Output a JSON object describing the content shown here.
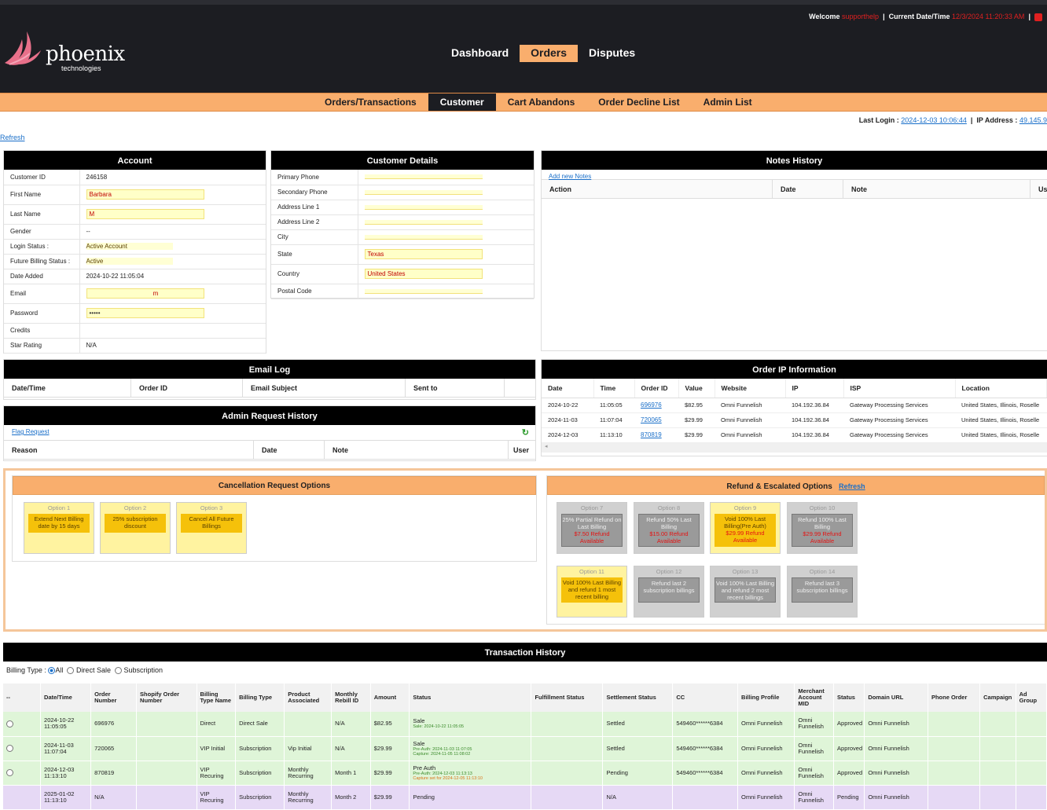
{
  "header": {
    "welcome_label": "Welcome",
    "username": "supporthelp",
    "datetime_label": "Current Date/Time",
    "datetime": "12/3/2024 11:20:33 AM",
    "separator": "|"
  },
  "logo": {
    "word": "phoenix",
    "sub": "technologies"
  },
  "main_nav": [
    {
      "label": "Dashboard",
      "active": false
    },
    {
      "label": "Orders",
      "active": true
    },
    {
      "label": "Disputes",
      "active": false
    }
  ],
  "sub_nav": [
    {
      "label": "Orders/Transactions",
      "active": false
    },
    {
      "label": "Customer",
      "active": true
    },
    {
      "label": "Cart Abandons",
      "active": false
    },
    {
      "label": "Order Decline List",
      "active": false
    },
    {
      "label": "Admin List",
      "active": false
    }
  ],
  "last_login": {
    "label": "Last Login :",
    "value": "2024-12-03 10:06:44",
    "ip_label": "IP Address :",
    "ip_value": "49.145.9"
  },
  "refresh_link": "Refresh",
  "account": {
    "title": "Account",
    "rows": [
      {
        "k": "Customer ID",
        "v": "246158"
      },
      {
        "k": "First Name",
        "v": "Barbara"
      },
      {
        "k": "Last Name",
        "v": "M"
      },
      {
        "k": "Gender",
        "v": "--"
      },
      {
        "k": "Login Status :",
        "v": "Active Account"
      },
      {
        "k": "Future Billing Status :",
        "v": "Active"
      },
      {
        "k": "Date Added",
        "v": "2024-10-22 11:05:04"
      },
      {
        "k": "Email",
        "v": "m"
      },
      {
        "k": "Password",
        "v": "•••••"
      },
      {
        "k": "Credits",
        "v": ""
      },
      {
        "k": "Star Rating",
        "v": "N/A"
      }
    ]
  },
  "customer_details": {
    "title": "Customer Details",
    "rows": [
      {
        "k": "Primary Phone",
        "v": ""
      },
      {
        "k": "Secondary Phone",
        "v": ""
      },
      {
        "k": "Address Line 1",
        "v": ""
      },
      {
        "k": "Address Line 2",
        "v": ""
      },
      {
        "k": "City",
        "v": ""
      },
      {
        "k": "State",
        "v": "Texas"
      },
      {
        "k": "Country",
        "v": "United States"
      },
      {
        "k": "Postal Code",
        "v": ""
      }
    ]
  },
  "notes": {
    "title": "Notes History",
    "add_link": "Add new Notes",
    "cols": [
      "Action",
      "Date",
      "Note",
      "Us"
    ]
  },
  "email_log": {
    "title": "Email Log",
    "cols": [
      "Date/Time",
      "Order ID",
      "Email Subject",
      "Sent to"
    ]
  },
  "admin_request": {
    "title": "Admin Request History",
    "flag_link": "Flag Request",
    "cols": [
      "Reason",
      "Date",
      "Note",
      "User"
    ]
  },
  "order_ip": {
    "title": "Order IP Information",
    "cols": [
      "Date",
      "Time",
      "Order ID",
      "Value",
      "Website",
      "IP",
      "ISP",
      "Location"
    ],
    "rows": [
      [
        "2024-10-22",
        "11:05:05",
        "696976",
        "$82.95",
        "Omni Funnelish",
        "104.192.36.84",
        "Gateway Processing Services",
        "United States, Illinois, Roselle"
      ],
      [
        "2024-11-03",
        "11:07:04",
        "720065",
        "$29.99",
        "Omni Funnelish",
        "104.192.36.84",
        "Gateway Processing Services",
        "United States, Illinois, Roselle"
      ],
      [
        "2024-12-03",
        "11:13:10",
        "870819",
        "$29.99",
        "Omni Funnelish",
        "104.192.36.84",
        "Gateway Processing Services",
        "United States, Illinois, Roselle"
      ]
    ]
  },
  "cancellation": {
    "title": "Cancellation Request Options",
    "options": [
      {
        "title": "Option 1",
        "text": "Extend Next Billing date by 15 days",
        "refund": ""
      },
      {
        "title": "Option 2",
        "text": "25% subscription discount",
        "refund": ""
      },
      {
        "title": "Option 3",
        "text": "Cancel All Future Billings",
        "refund": ""
      }
    ]
  },
  "refund": {
    "title": "Refund & Escalated Options",
    "refresh": "Refresh",
    "options": [
      {
        "title": "Option 7",
        "text": "25% Partial Refund on Last Billing",
        "refund": "$7.50 Refund Available",
        "style": "g"
      },
      {
        "title": "Option 8",
        "text": "Refund 50% Last Billing",
        "refund": "$15.00 Refund Available",
        "style": "g"
      },
      {
        "title": "Option 9",
        "text": "Void 100% Last Billing(Pre Auth)",
        "refund": "$29.99 Refund Available",
        "style": "y"
      },
      {
        "title": "Option 10",
        "text": "Refund 100% Last Billing",
        "refund": "$29.99 Refund Available",
        "style": "g"
      },
      {
        "title": "Option 11",
        "text": "Void 100% Last Billing and refund 1 most recent billing",
        "refund": "",
        "style": "y"
      },
      {
        "title": "Option 12",
        "text": "Refund last 2 subscription billings",
        "refund": "",
        "style": "g"
      },
      {
        "title": "Option 13",
        "text": "Void 100% Last Billing and refund 2 most recent billings",
        "refund": "",
        "style": "g"
      },
      {
        "title": "Option 14",
        "text": "Refund last 3 subscription billings",
        "refund": "",
        "style": "g"
      }
    ]
  },
  "transactions": {
    "title": "Transaction History",
    "billing_type_label": "Billing Type :",
    "filters": [
      "All",
      "Direct Sale",
      "Subscription"
    ],
    "cols": [
      "--",
      "Date/Time",
      "Order Number",
      "Shopify Order Number",
      "Billing Type Name",
      "Billing Type",
      "Product Associated",
      "Monthly Rebill ID",
      "Amount",
      "Status",
      "Fulfillment Status",
      "Settlement Status",
      "CC",
      "Billing Profile",
      "Merchant Account MID",
      "Status",
      "Domain URL",
      "Phone Order",
      "Campaign",
      "Ad Group"
    ],
    "rows": [
      {
        "cls": "green",
        "date": "2024-10-22",
        "time": "11:05:05",
        "order": "696976",
        "btname": "Direct",
        "btype": "Direct Sale",
        "product": "",
        "rebill": "N/A",
        "amount": "$82.95",
        "status": "Sale",
        "sub1": "Sale: 2024-10-22 11:05:05",
        "sub2": "",
        "settle": "Settled",
        "cc": "549460******6384",
        "profile": "Omni Funnelish",
        "mid": "Omni Funnelish",
        "st": "Approved",
        "domain": "Omni Funnelish"
      },
      {
        "cls": "green",
        "date": "2024-11-03",
        "time": "11:07:04",
        "order": "720065",
        "btname": "VIP Initial",
        "btype": "Subscription",
        "product": "Vip Initial",
        "rebill": "N/A",
        "amount": "$29.99",
        "status": "Sale",
        "sub1": "Pre-Auth: 2024-11-03 11:07:05",
        "sub2": "Capture: 2024-11-05 11:08:02",
        "settle": "Settled",
        "cc": "549460******6384",
        "profile": "Omni Funnelish",
        "mid": "Omni Funnelish",
        "st": "Approved",
        "domain": "Omni Funnelish"
      },
      {
        "cls": "green",
        "date": "2024-12-03",
        "time": "11:13:10",
        "order": "870819",
        "btname": "VIP Recuring",
        "btype": "Subscription",
        "product": "Monthly Recurring",
        "rebill": "Month 1",
        "amount": "$29.99",
        "status": "Pre Auth",
        "sub1": "Pre-Auth: 2024-12-03 11:13:13",
        "sub2": "Capture set for 2024-12-05 11:13:10",
        "settle": "Pending",
        "cc": "549460******6384",
        "profile": "Omni Funnelish",
        "mid": "Omni Funnelish",
        "st": "Approved",
        "domain": "Omni Funnelish"
      },
      {
        "cls": "purple",
        "date": "2025-01-02",
        "time": "11:13:10",
        "order": "N/A",
        "btname": "VIP Recuring",
        "btype": "Subscription",
        "product": "Monthly Recurring",
        "rebill": "Month 2",
        "amount": "$29.99",
        "status": "Pending",
        "sub1": "",
        "sub2": "",
        "settle": "N/A",
        "cc": "",
        "profile": "Omni Funnelish",
        "mid": "Omni Funnelish",
        "st": "Pending",
        "domain": "Omni Funnelish"
      }
    ]
  }
}
